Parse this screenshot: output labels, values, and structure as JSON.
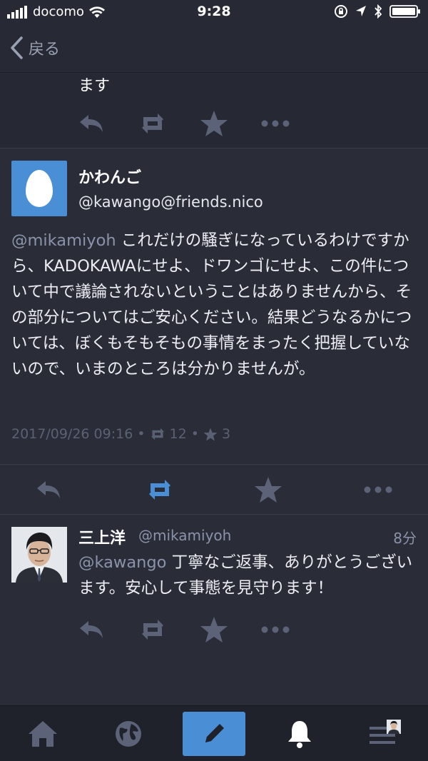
{
  "status_bar": {
    "carrier": "docomo",
    "time": "9:28"
  },
  "nav": {
    "back_label": "戻る"
  },
  "previous_status": {
    "text_tail": "ます"
  },
  "main_status": {
    "display_name": "かわんご",
    "handle": "@kawango@friends.nico",
    "mention": "@mikamiyoh",
    "text": " これだけの騒ぎになっているわけですから、KADOKAWAにせよ、ドワンゴにせよ、この件について中で議論されないということはありませんから、その部分についてはご安心ください。結果どうなるかについては、ぼくもそもそもの事情をまったく把握していないので、いまのところは分かりませんが。",
    "timestamp": "2017/09/26 09:16",
    "boost_count": "12",
    "favourite_count": "3"
  },
  "reply_status": {
    "display_name": "三上洋",
    "handle": "@mikamiyoh",
    "relative_time": "8分",
    "mention": "@kawango",
    "text": " 丁寧なご返事、ありがとうございます。安心して事態を見守ります！"
  },
  "icons": {
    "reply": "reply-icon",
    "boost": "boost-icon",
    "favourite": "star-icon",
    "more": "more-icon",
    "home": "home-icon",
    "globe": "globe-icon",
    "compose": "pencil-icon",
    "notifications": "bell-icon",
    "menu": "menu-icon"
  },
  "colors": {
    "background": "#2a2d38",
    "accent": "#4a8fd6",
    "muted": "#5b6175",
    "icon_gray": "#5c6378"
  }
}
